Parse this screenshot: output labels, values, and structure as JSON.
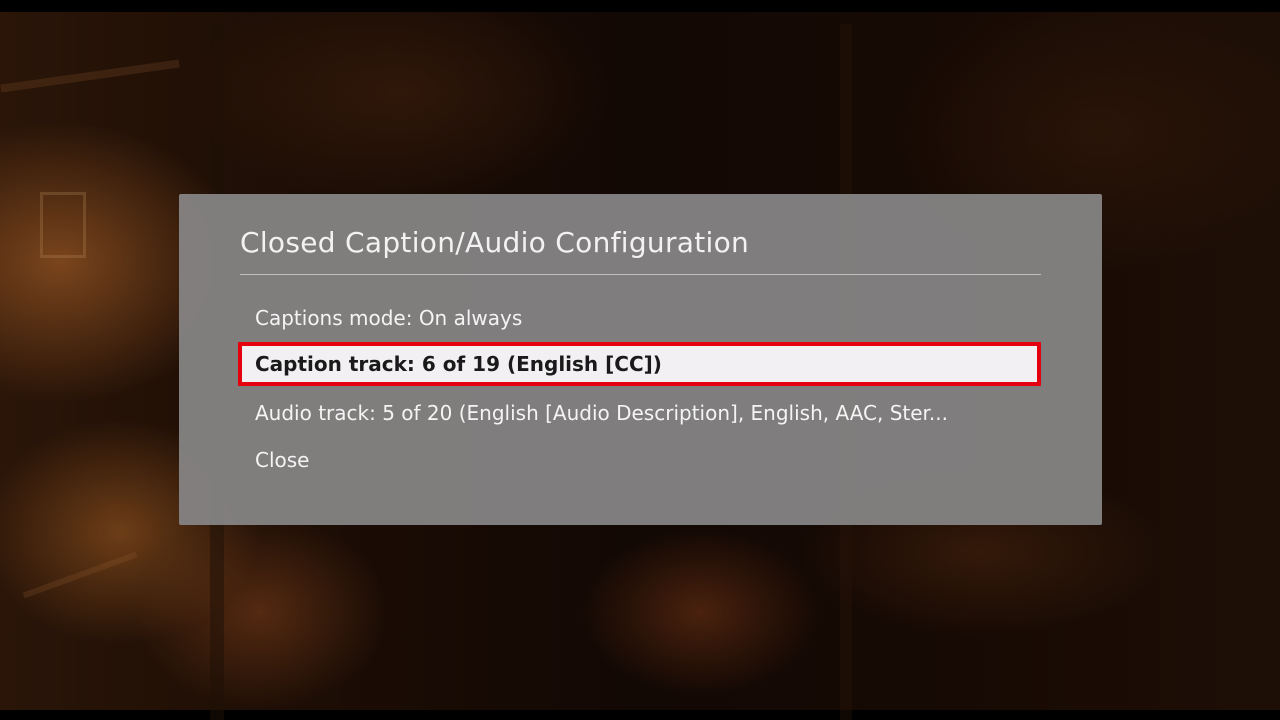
{
  "dialog": {
    "title": "Closed Caption/Audio Configuration",
    "items": [
      {
        "label": "Captions mode: On always",
        "selected": false
      },
      {
        "label": "Caption track: 6 of 19 (English [CC])",
        "selected": true
      },
      {
        "label": "Audio track: 5 of 20 (English [Audio Description], English, AAC, Ster...",
        "selected": false
      },
      {
        "label": "Close",
        "selected": false
      }
    ]
  },
  "colors": {
    "dialog_background": "#848282",
    "selected_background": "#f2f0f2",
    "selection_border": "#e4000f",
    "text": "#f4f4f4"
  }
}
